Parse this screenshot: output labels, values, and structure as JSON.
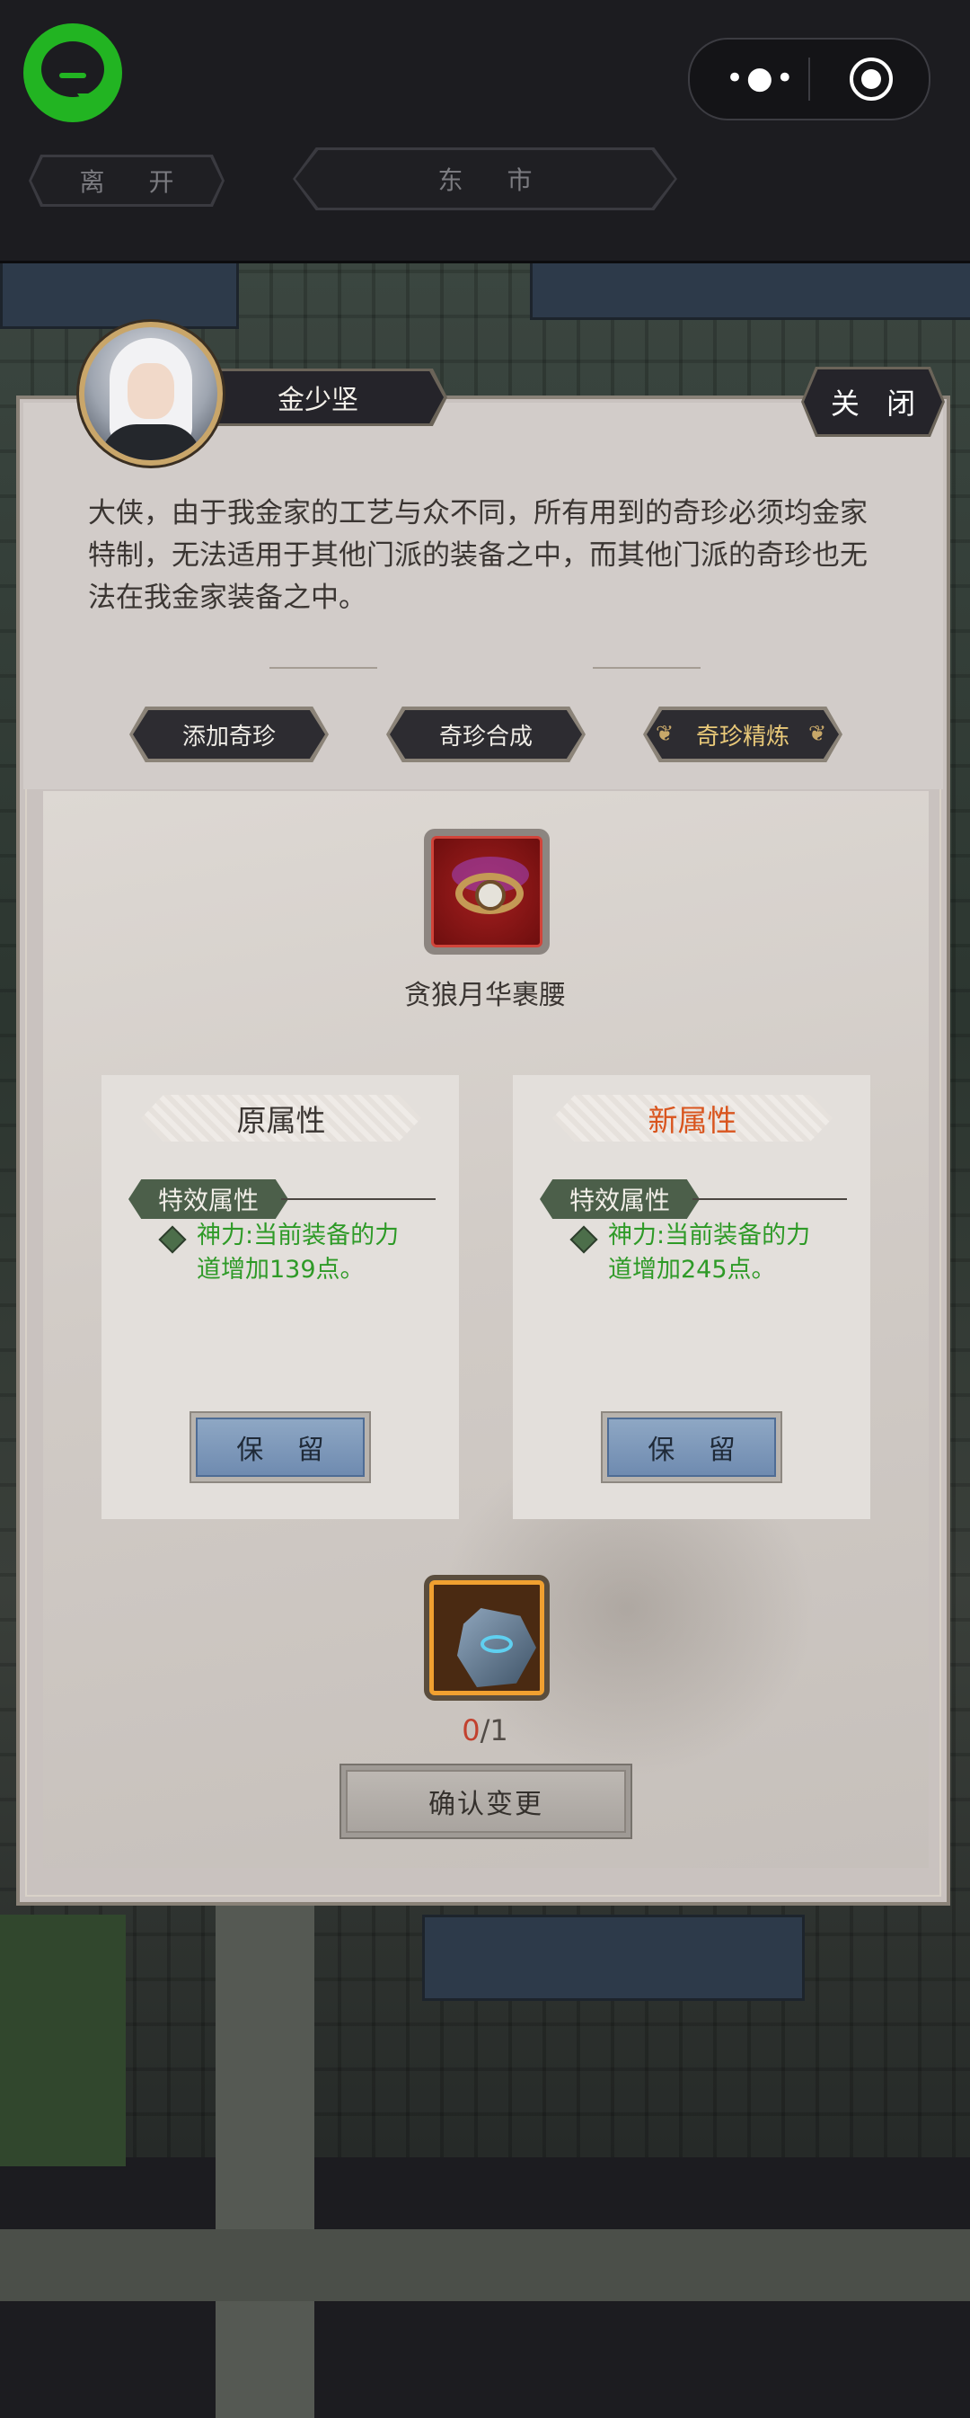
{
  "topbar": {
    "leave_label": "离 开",
    "location_label": "东 市",
    "menu_dots": "•●•"
  },
  "npc": {
    "name": "金少坚",
    "close_label": "关 闭",
    "dialogue": "大侠，由于我金家的工艺与众不同，所有用到的奇珍必须均金家特制，无法适用于其他门派的装备之中，而其他门派的奇珍也无法在我金家装备之中。"
  },
  "tabs": [
    {
      "label": "添加奇珍",
      "active": false
    },
    {
      "label": "奇珍合成",
      "active": false
    },
    {
      "label": "奇珍精炼",
      "active": true
    }
  ],
  "item": {
    "name": "贪狼月华裹腰",
    "icon": "belt-icon"
  },
  "old_attr": {
    "title": "原属性",
    "tag": "特效属性",
    "effect": "神力:当前装备的力道增加139点。",
    "keep_label": "保 留"
  },
  "new_attr": {
    "title": "新属性",
    "tag": "特效属性",
    "effect": "神力:当前装备的力道增加245点。",
    "keep_label": "保 留"
  },
  "material": {
    "icon": "refine-stone-icon",
    "have": "0",
    "need": "/1"
  },
  "confirm_label": "确认变更",
  "colors": {
    "effect_green": "#2e9a27",
    "new_title_orange": "#d9551e",
    "count_red": "#c2412e",
    "logo_green": "#22b422"
  }
}
